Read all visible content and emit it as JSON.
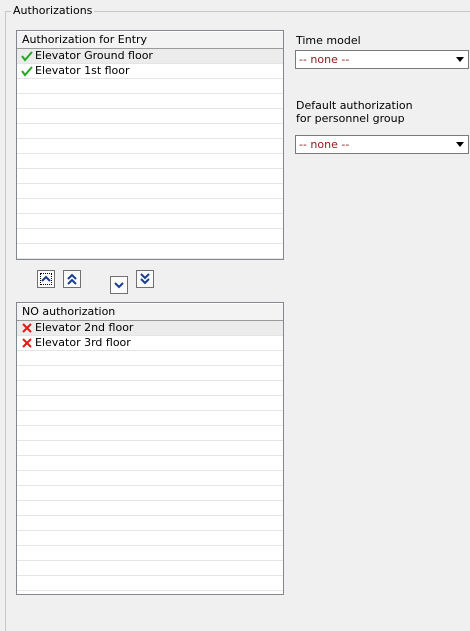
{
  "group": {
    "title": "Authorizations"
  },
  "authorized_list": {
    "header": "Authorization for Entry",
    "items": [
      {
        "label": "Elevator Ground floor",
        "icon": "checkmark-icon",
        "selected": true
      },
      {
        "label": "Elevator 1st floor",
        "icon": "checkmark-icon",
        "selected": false
      }
    ]
  },
  "unauthorized_list": {
    "header": "NO authorization",
    "items": [
      {
        "label": "Elevator 2nd floor",
        "icon": "cross-icon",
        "selected": true
      },
      {
        "label": "Elevator 3rd floor",
        "icon": "cross-icon",
        "selected": false
      }
    ]
  },
  "move_buttons": [
    {
      "name": "move-up-button",
      "icon": "chevron-up-icon"
    },
    {
      "name": "move-all-up-button",
      "icon": "double-chevron-up-icon"
    },
    {
      "name": "move-down-button",
      "icon": "chevron-down-icon"
    },
    {
      "name": "move-all-down-button",
      "icon": "double-chevron-down-icon"
    }
  ],
  "time_model": {
    "label": "Time model",
    "value": "-- none --"
  },
  "default_authorization": {
    "label_line1": "Default authorization",
    "label_line2": "for personnel group",
    "value": "-- none --"
  },
  "colors": {
    "check": "#1faa1f",
    "cross": "#e01b1b",
    "combo_text": "#8b1a1a"
  }
}
